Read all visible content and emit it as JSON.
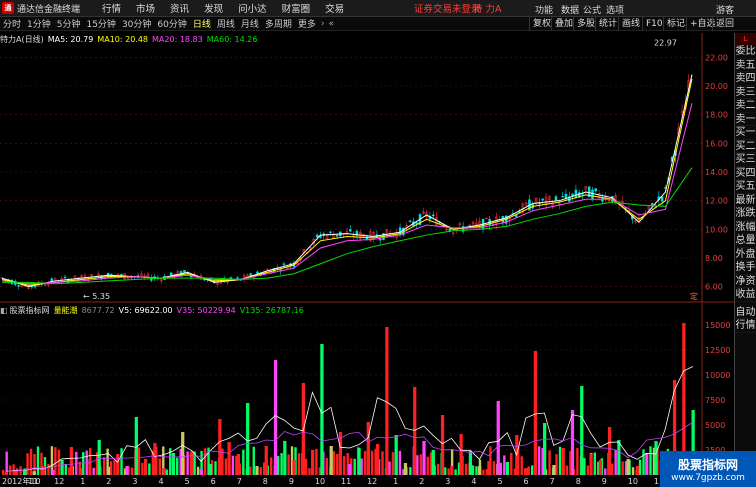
{
  "titlebar": {
    "app_name": "通达信金融终端",
    "menus": [
      "行情",
      "市场",
      "资讯",
      "发现",
      "问小达",
      "财富圈",
      "交易"
    ],
    "warning": "证券交易未登录",
    "stock": "特 力A",
    "right_menus": [
      "功能",
      "数据",
      "公式",
      "选项",
      "游客"
    ]
  },
  "periodbar": {
    "periods": [
      "分时",
      "1分钟",
      "5分钟",
      "15分钟",
      "30分钟",
      "60分钟",
      "日线",
      "周线",
      "月线",
      "多周期",
      "更多"
    ],
    "active": "日线",
    "right_buttons": [
      "复权",
      "叠加",
      "多股",
      "统计",
      "画线",
      "F10",
      "标记",
      "+自选",
      "返回"
    ]
  },
  "main_header": {
    "name": "特力A(日线)",
    "ma5": "MA5: 20.79",
    "ma10": "MA10: 20.48",
    "ma20": "MA20: 18.83",
    "ma60": "MA60: 14.26",
    "colors": {
      "ma5": "#ffffff",
      "ma10": "#ffff00",
      "ma20": "#ff44ff",
      "ma60": "#00dd00"
    }
  },
  "main_chart": {
    "y_ticks": [
      "22.00",
      "20.00",
      "18.00",
      "16.00",
      "14.00",
      "12.00",
      "10.00",
      "8.00",
      "6.00"
    ],
    "high_label": "22.97",
    "low_label": "5.35",
    "corner_label": "定"
  },
  "chart_data": {
    "type": "line",
    "title": "特力A(日线)",
    "xlabel": "",
    "ylabel": "",
    "ylim": [
      5,
      23
    ],
    "x": [
      "2012年10",
      "11",
      "12",
      "1",
      "2",
      "3",
      "4",
      "5",
      "6",
      "7",
      "8",
      "9",
      "10",
      "11",
      "12",
      "1",
      "2",
      "3",
      "4",
      "5",
      "6",
      "7",
      "8",
      "9",
      "10",
      "11",
      "12"
    ],
    "series": [
      {
        "name": "MA5",
        "values": [
          6.6,
          6.0,
          6.4,
          6.6,
          6.8,
          6.7,
          6.6,
          7.0,
          6.3,
          6.5,
          7.1,
          7.6,
          9.6,
          9.7,
          9.5,
          9.8,
          11.0,
          10.0,
          10.3,
          10.8,
          11.8,
          12.0,
          12.6,
          12.2,
          10.5,
          12.6,
          20.8
        ]
      },
      {
        "name": "MA10",
        "values": [
          6.5,
          6.1,
          6.3,
          6.5,
          6.7,
          6.7,
          6.6,
          6.9,
          6.4,
          6.5,
          7.0,
          7.5,
          9.2,
          9.5,
          9.4,
          9.7,
          10.7,
          10.0,
          10.2,
          10.7,
          11.6,
          11.9,
          12.4,
          12.1,
          10.7,
          12.0,
          20.5
        ]
      },
      {
        "name": "MA20",
        "values": [
          6.4,
          6.2,
          6.3,
          6.4,
          6.6,
          6.7,
          6.6,
          6.8,
          6.5,
          6.5,
          6.9,
          7.3,
          8.7,
          9.2,
          9.3,
          9.6,
          10.3,
          10.1,
          10.1,
          10.5,
          11.3,
          11.7,
          12.1,
          12.1,
          11.0,
          11.4,
          18.8
        ]
      },
      {
        "name": "MA60",
        "values": [
          6.3,
          6.3,
          6.2,
          6.3,
          6.4,
          6.5,
          6.6,
          6.6,
          6.6,
          6.5,
          6.6,
          6.9,
          7.6,
          8.3,
          8.8,
          9.2,
          9.6,
          9.9,
          10.0,
          10.2,
          10.7,
          11.1,
          11.6,
          11.9,
          11.7,
          11.6,
          14.3
        ]
      }
    ],
    "max_label": 22.97,
    "min_label": 5.35
  },
  "volume_panel": {
    "name": "股票指标网",
    "indicator": "量能潮",
    "val1": "8677.72",
    "v5": "V5: 69622.00",
    "v35": "V35: 50229.94",
    "v135": "V135: 26787.16",
    "y_ticks": [
      "15000",
      "12500",
      "10000",
      "7500",
      "5000",
      "2500"
    ],
    "x_labels": [
      "2012年10",
      "11",
      "12",
      "1",
      "2",
      "3",
      "4",
      "5",
      "6",
      "7",
      "8",
      "9",
      "10",
      "11",
      "12",
      "1",
      "2",
      "3",
      "4",
      "5",
      "6",
      "7",
      "8",
      "9",
      "10",
      "11",
      "12"
    ],
    "bars": [
      300,
      420,
      650,
      380,
      900,
      520,
      1500,
      2800,
      700,
      1600,
      3500,
      820,
      2100,
      900,
      5800,
      1600,
      3200,
      700,
      2200,
      4300,
      2400,
      600,
      1100,
      5600,
      3300,
      2100,
      7200,
      900,
      2900,
      11500,
      3400,
      1500,
      9200,
      2500,
      13100,
      2900,
      4300,
      1100,
      2700,
      5300,
      3100,
      14800,
      4000,
      1200,
      8800,
      3400,
      2500,
      6000,
      900,
      4100,
      2400,
      900,
      1400,
      7400,
      1300,
      4000,
      700,
      12400,
      5200,
      1000,
      2700,
      6500,
      8900,
      2100,
      1500,
      4800,
      3500,
      1600,
      900,
      2200,
      3400,
      700,
      9500,
      15200,
      6500
    ],
    "colors": [
      "#ff2020",
      "#ff2020",
      "#00ff66",
      "#c8c860",
      "#ff2020",
      "#ff44ff",
      "#00ff66",
      "#ff2020"
    ]
  },
  "rightpanel": {
    "items": [
      "委比",
      "卖五",
      "卖四",
      "卖三",
      "卖二",
      "卖一",
      "买一",
      "买二",
      "买三",
      "买四",
      "买五",
      "最新",
      "涨跌",
      "涨幅",
      "总量",
      "外盘",
      "换手",
      "净资",
      "收益",
      "自动",
      "行情"
    ]
  },
  "watermark": {
    "line1": "股票指标网",
    "line2": "www.7gpzb.com"
  }
}
